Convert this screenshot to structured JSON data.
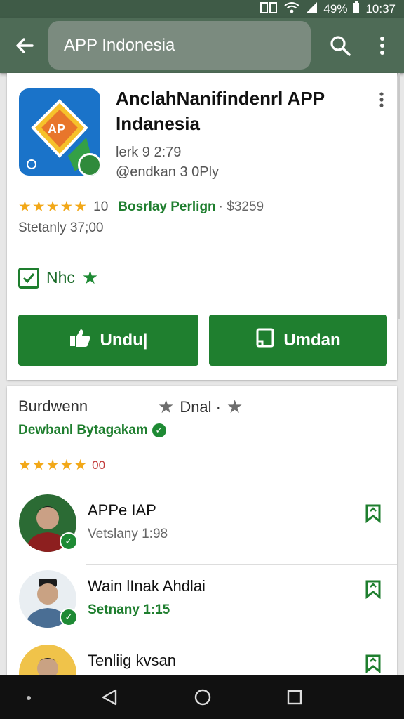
{
  "status_bar": {
    "battery": "49%",
    "time": "10:37"
  },
  "toolbar": {
    "search_text": "APP Indonesia",
    "back_icon": "arrow-left-icon",
    "search_icon": "search-icon",
    "more_icon": "more-vert-icon"
  },
  "app": {
    "title": "AnclahNanifindenrl APP Indanesia",
    "icon_text": "AP",
    "meta_line1": "lerk 9 2:79",
    "meta_line2": "@endkan 3 0Ply",
    "stars": "★★★★★",
    "rating_count": "10",
    "developer": "Bosrlay Perlign",
    "price": "· $3259",
    "updated": "Stetanly 37;00",
    "badge_label": "Nhc"
  },
  "buttons": {
    "primary_label": "Undu|",
    "secondary_label": "Umdan"
  },
  "section": {
    "title": "Burdwenn",
    "right_label": "Dnal ·",
    "developer": "Dewbanl Bytagakam",
    "stars": "★★★★★",
    "rating": "00"
  },
  "list": [
    {
      "name": "APPe IAP",
      "sub": "Vetslany 1:98",
      "sub_style": "grey"
    },
    {
      "name": "Wain lInak Ahdlai",
      "sub": "Setnany 1:15",
      "sub_style": "green"
    },
    {
      "name": "Tenliig kvsan",
      "sub": "",
      "sub_style": "grey"
    }
  ],
  "colors": {
    "toolbar": "#4e6b56",
    "status_bar": "#3f5b47",
    "accent_green": "#1f7f2f",
    "star": "#f2a818"
  }
}
